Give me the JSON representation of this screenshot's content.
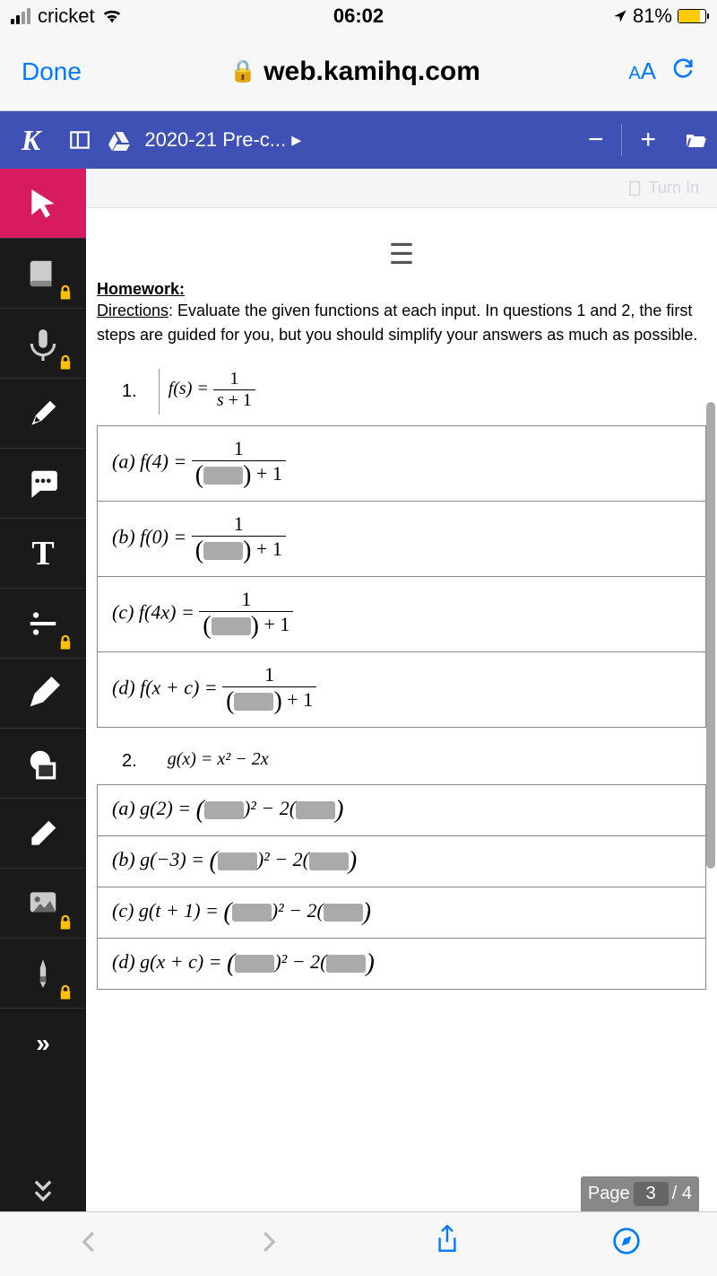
{
  "status": {
    "carrier": "cricket",
    "time": "06:02",
    "battery_pct": "81%"
  },
  "browser": {
    "done": "Done",
    "url": "web.kamihq.com",
    "aa": "AA"
  },
  "app_bar": {
    "logo": "K",
    "filename": "2020-21 Pre-c... ▸",
    "minus": "−",
    "plus": "+"
  },
  "turn_in": "Turn In",
  "homework": {
    "title": "Homework:",
    "directions_label": "Directions",
    "directions_text": ": Evaluate the given functions at each input. In questions 1 and 2, the first steps are guided for you, but you should simplify your answers as much as possible."
  },
  "p1": {
    "num": "1.",
    "func_lhs": "f(s) = ",
    "frac_num": "1",
    "frac_den_var": "s",
    "frac_den_plus": " + 1",
    "rows": {
      "a": "(a)  f(4) = ",
      "b": "(b)  f(0) = ",
      "c": "(c)  f(4x) = ",
      "d": "(d)  f(x + c) = "
    },
    "row_frac_num": "1",
    "row_frac_suffix": " + 1"
  },
  "p2": {
    "num": "2.",
    "func_def": "g(x) = x² − 2x",
    "rows": {
      "a_lhs": "(a)  g(2) = ",
      "b_lhs": "(b)  g(−3) = ",
      "c_lhs": "(c)  g(t + 1) = ",
      "d_lhs": "(d)  g(x + c) = "
    },
    "sq": ")² − 2("
  },
  "pagebar": {
    "label": "Page",
    "current": "3",
    "total": "/ 4"
  },
  "sidebar_more": "»",
  "sidebar_collapse": "⌄"
}
